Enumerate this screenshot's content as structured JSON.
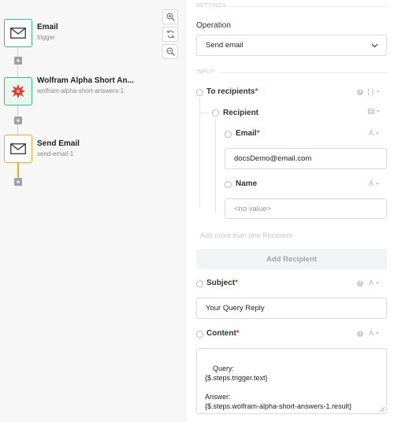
{
  "workflow": {
    "nodes": [
      {
        "title": "Email",
        "subtitle": "trigger",
        "icon": "envelope-icon"
      },
      {
        "title": "Wolfram Alpha Short An...",
        "subtitle": "wolfram-alpha-short-answers-1",
        "icon": "wolfram-alpha-icon"
      },
      {
        "title": "Send Email",
        "subtitle": "send-email-1",
        "icon": "envelope-icon"
      }
    ],
    "plus_label": "+",
    "accent_color": "#f5a623",
    "node_border_color": "#3fb68b"
  },
  "settings": {
    "section_label": "SETTINGS",
    "operation_label": "Operation",
    "operation_value": "Send email"
  },
  "input": {
    "section_label": "INPUT",
    "to_recipients": {
      "label": "To recipients",
      "required": "*",
      "type": "{ }"
    },
    "recipient": {
      "label": "Recipient",
      "type": "list"
    },
    "email": {
      "label": "Email",
      "required": "*",
      "type": "A",
      "value": "docsDemo@email.com"
    },
    "name": {
      "label": "Name",
      "type": "A",
      "value": "<no value>"
    },
    "add_more_hint": "Add more than one Recipient",
    "add_recipient_button": "Add Recipient",
    "subject": {
      "label": "Subject",
      "required": "*",
      "type": "A",
      "value": "Your Query Reply"
    },
    "content": {
      "label": "Content",
      "required": "*",
      "type": "A",
      "value": "Query:\n{$.steps.trigger.text}\n\nAnswer:\n{$.steps.wolfram-alpha-short-answers-1.result}"
    }
  },
  "help_glyph": "?"
}
